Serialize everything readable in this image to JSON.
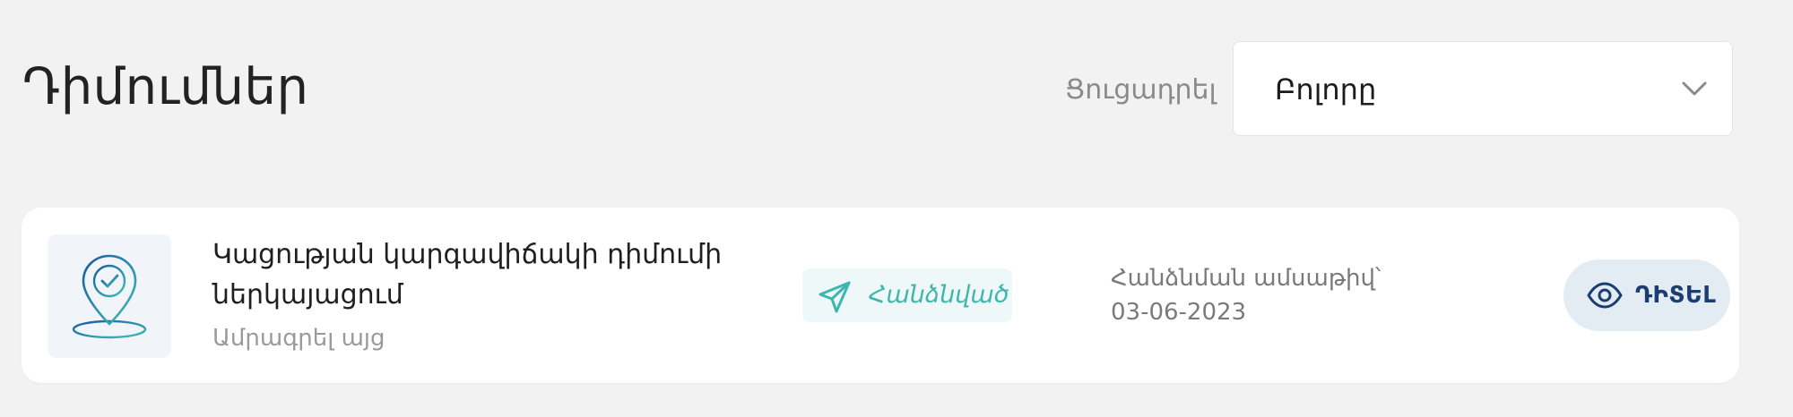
{
  "page": {
    "title": "Դիմումներ"
  },
  "filter": {
    "label": "Ցուցադրել",
    "selected": "Բոլորը",
    "chevron_icon": "chevron-down-icon"
  },
  "applications": [
    {
      "icon": "location-check-icon",
      "title": "Կացության կարգավիճակի դիմումի ներկայացում",
      "subtitle": "Ամրագրել այց",
      "status": {
        "icon": "send-icon",
        "label": "Հանձնված",
        "color": "#3fb6ad"
      },
      "date_label": "Հանձնման ամսաթիվ՝",
      "date_value": "03-06-2023",
      "view_button": {
        "icon": "eye-icon",
        "label": "ԴԻՏԵԼ"
      }
    }
  ],
  "colors": {
    "background": "#f2f2f2",
    "accent_teal": "#3fb6ad",
    "button_text": "#1c3d72",
    "button_bg": "#e3ebf3"
  }
}
